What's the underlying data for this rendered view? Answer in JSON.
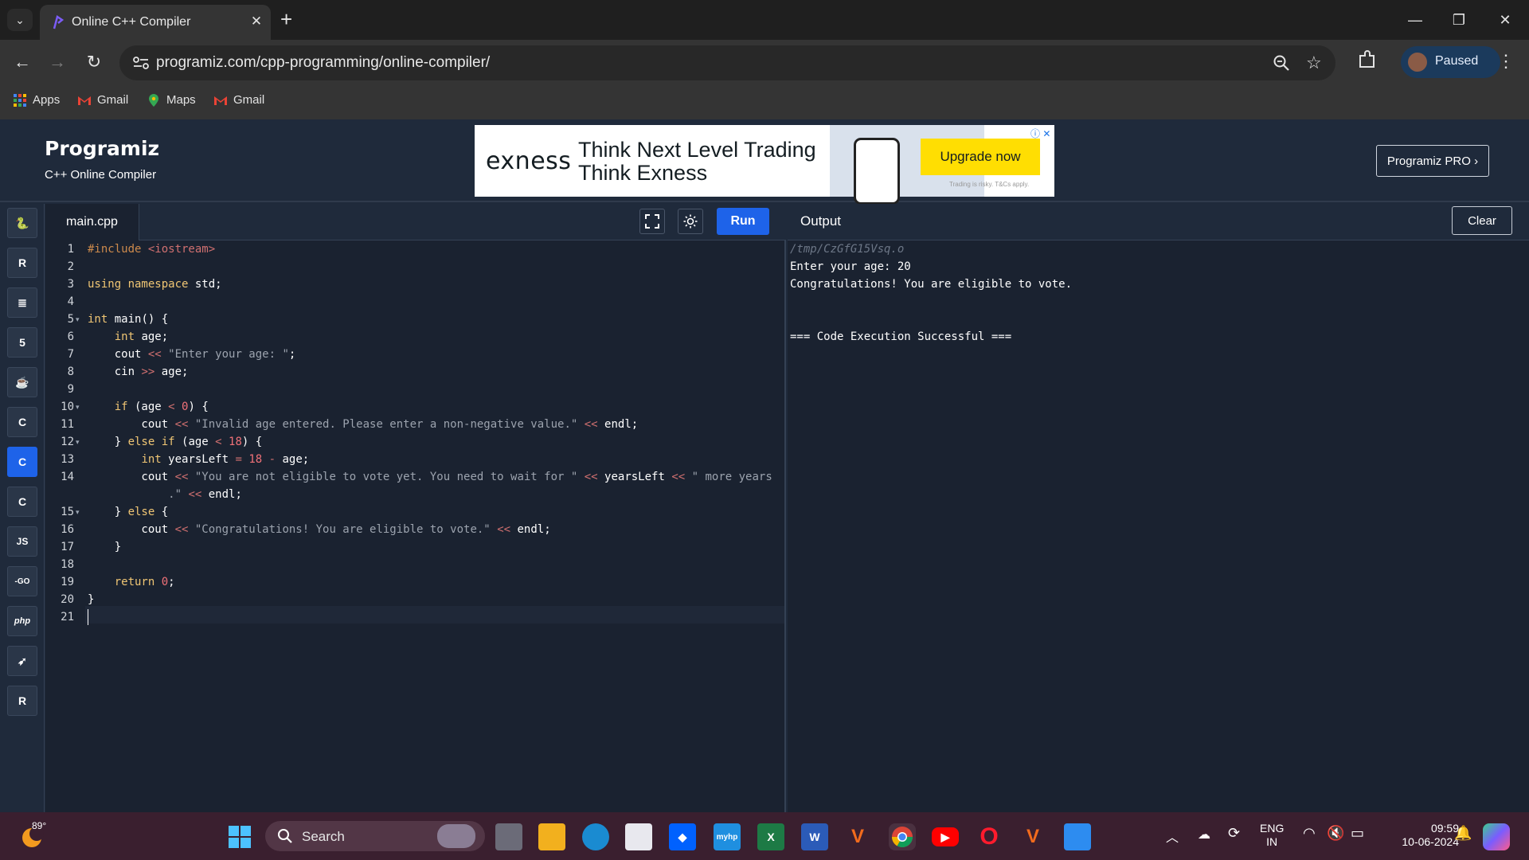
{
  "browser": {
    "tab_title": "Online C++ Compiler",
    "url": "programiz.com/cpp-programming/online-compiler/",
    "profile_label": "Paused",
    "bookmarks": [
      "Apps",
      "Gmail",
      "Maps",
      "Gmail"
    ]
  },
  "header": {
    "logo": "Programiz",
    "subtitle": "C++ Online Compiler",
    "pro_button": "Programiz PRO ›"
  },
  "ad": {
    "brand": "exness",
    "line1": "Think Next Level Trading",
    "line2": "Think Exness",
    "cta": "Upgrade now",
    "disclaimer": "Trading is risky. T&Cs apply."
  },
  "languages": [
    {
      "name": "python-icon",
      "glyph": "🐍"
    },
    {
      "name": "r-icon",
      "glyph": "R"
    },
    {
      "name": "sql-icon",
      "glyph": "≣"
    },
    {
      "name": "html-icon",
      "glyph": "5"
    },
    {
      "name": "java-icon",
      "glyph": "☕"
    },
    {
      "name": "c-icon",
      "glyph": "C"
    },
    {
      "name": "cpp-icon",
      "glyph": "C"
    },
    {
      "name": "csharp-icon",
      "glyph": "C"
    },
    {
      "name": "js-icon",
      "glyph": "JS"
    },
    {
      "name": "go-icon",
      "glyph": "-GO"
    },
    {
      "name": "php-icon",
      "glyph": "php"
    },
    {
      "name": "swift-icon",
      "glyph": "➶"
    },
    {
      "name": "rust-icon",
      "glyph": "R"
    }
  ],
  "editor": {
    "file_tab": "main.cpp",
    "run_label": "Run",
    "lines": [
      "1",
      "2",
      "3",
      "4",
      "5",
      "6",
      "7",
      "8",
      "9",
      "10",
      "11",
      "12",
      "13",
      "14",
      "",
      "15",
      "16",
      "17",
      "18",
      "19",
      "20",
      "21"
    ]
  },
  "output": {
    "title": "Output",
    "clear_label": "Clear",
    "lines": [
      "/tmp/CzGfG15Vsq.o",
      "Enter your age: 20",
      "Congratulations! You are eligible to vote.",
      "",
      "=== Code Execution Successful ==="
    ]
  },
  "taskbar": {
    "temperature": "89°",
    "search_label": "Search",
    "language": "ENG",
    "region": "IN",
    "time": "09:59",
    "date": "10-06-2024"
  }
}
